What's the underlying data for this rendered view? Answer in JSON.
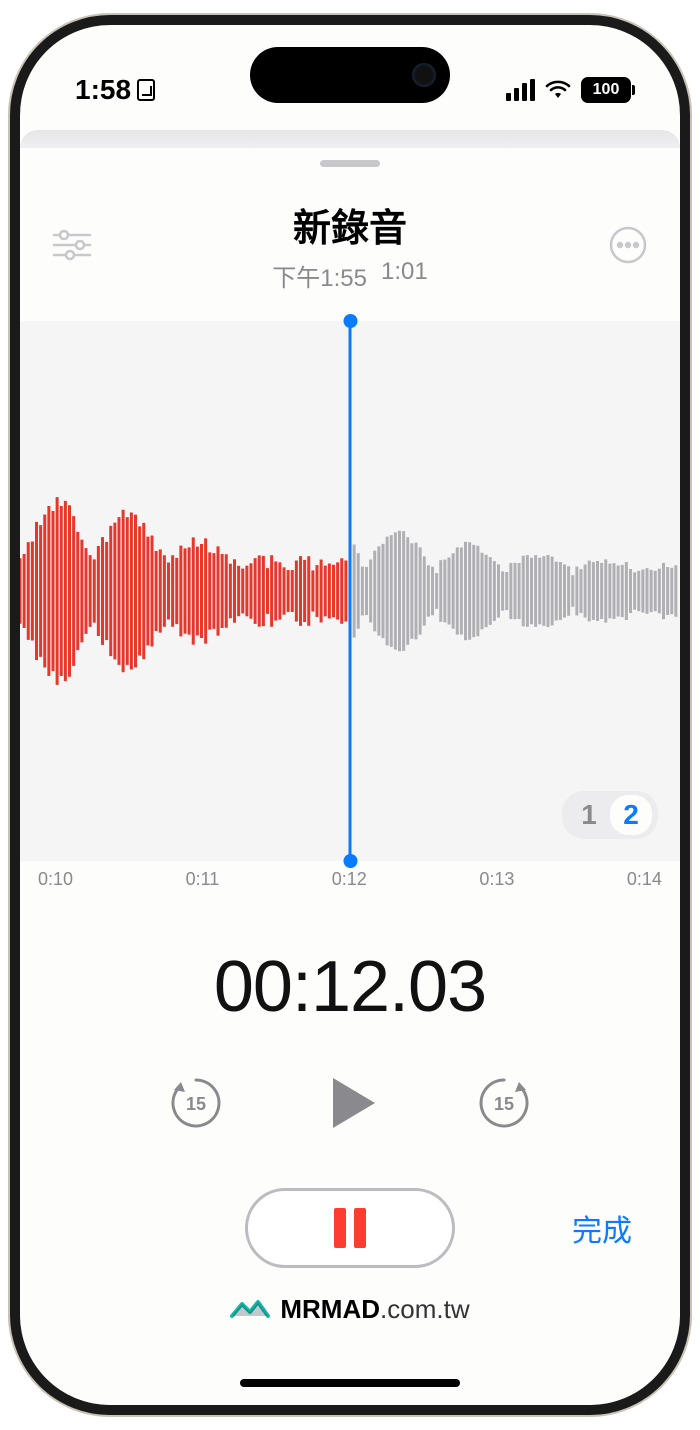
{
  "status_bar": {
    "time": "1:58",
    "battery_pct": "100"
  },
  "recording": {
    "title": "新錄音",
    "created_time": "下午1:55",
    "duration": "1:01"
  },
  "waveform": {
    "playhead_time": "0:12",
    "ticks": [
      "0:10",
      "0:11",
      "0:12",
      "0:13",
      "0:14"
    ]
  },
  "layers": {
    "inactive": "1",
    "active": "2"
  },
  "elapsed": "00:12.03",
  "transport": {
    "skip_back_seconds": "15",
    "skip_forward_seconds": "15"
  },
  "buttons": {
    "done": "完成"
  },
  "watermark": {
    "brand": "MRMAD",
    "domain": ".com.tw"
  }
}
